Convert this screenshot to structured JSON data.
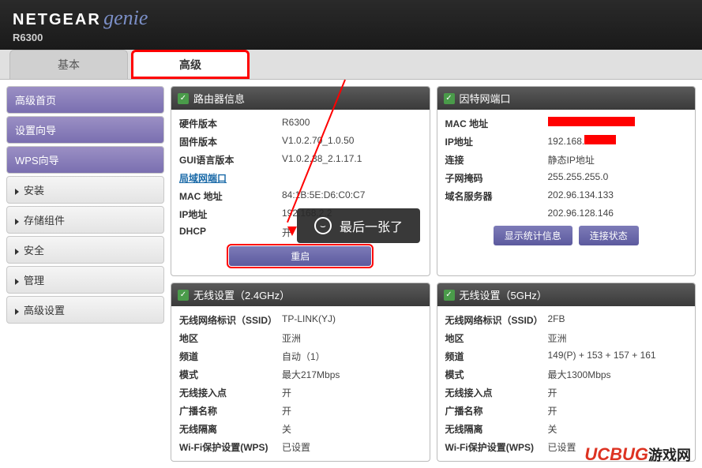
{
  "header": {
    "brand": "NETGEAR",
    "genie": "genie",
    "model": "R6300"
  },
  "tabs": {
    "basic": "基本",
    "advanced": "高级"
  },
  "sidebar": [
    {
      "label": "高级首页",
      "active": true,
      "arrow": false
    },
    {
      "label": "设置向导",
      "active": true,
      "arrow": false
    },
    {
      "label": "WPS向导",
      "active": true,
      "arrow": false
    },
    {
      "label": "安装",
      "active": false,
      "arrow": true
    },
    {
      "label": "存储组件",
      "active": false,
      "arrow": true
    },
    {
      "label": "安全",
      "active": false,
      "arrow": true
    },
    {
      "label": "管理",
      "active": false,
      "arrow": true
    },
    {
      "label": "高级设置",
      "active": false,
      "arrow": true
    }
  ],
  "panels": {
    "router": {
      "title": "路由器信息",
      "rows": [
        {
          "k": "硬件版本",
          "v": "R6300"
        },
        {
          "k": "固件版本",
          "v": "V1.0.2.70_1.0.50"
        },
        {
          "k": "GUI语言版本",
          "v": "V1.0.2.38_2.1.17.1"
        }
      ],
      "lanlink": "局域网端口",
      "rows2": [
        {
          "k": "MAC 地址",
          "v": "84:1B:5E:D6:C0:C7"
        },
        {
          "k": "IP地址",
          "v": "192.168.2.2"
        },
        {
          "k": "DHCP",
          "v": "开"
        }
      ],
      "btn": "重启"
    },
    "internet": {
      "title": "因特网端口",
      "rows": [
        {
          "k": "MAC 地址",
          "v": "",
          "red": true
        },
        {
          "k": "IP地址",
          "v": "192.168.",
          "red2": true
        },
        {
          "k": "连接",
          "v": "静态IP地址"
        },
        {
          "k": "子网掩码",
          "v": "255.255.255.0"
        },
        {
          "k": "域名服务器",
          "v": "202.96.134.133"
        },
        {
          "k": "",
          "v": "202.96.128.146"
        }
      ],
      "btn1": "显示统计信息",
      "btn2": "连接状态"
    },
    "w24": {
      "title": "无线设置（2.4GHz）",
      "rows": [
        {
          "k": "无线网络标识（SSID）",
          "v": "TP-LINK(YJ)"
        },
        {
          "k": "地区",
          "v": "亚洲"
        },
        {
          "k": "频道",
          "v": "自动（1）"
        },
        {
          "k": "模式",
          "v": "最大217Mbps"
        },
        {
          "k": "无线接入点",
          "v": "开"
        },
        {
          "k": "广播名称",
          "v": "开"
        },
        {
          "k": "无线隔离",
          "v": "关"
        },
        {
          "k": "Wi-Fi保护设置(WPS)",
          "v": "已设置"
        }
      ]
    },
    "w5": {
      "title": "无线设置（5GHz）",
      "rows": [
        {
          "k": "无线网络标识（SSID）",
          "v": "2FB"
        },
        {
          "k": "地区",
          "v": "亚洲"
        },
        {
          "k": "频道",
          "v": "149(P) + 153 + 157 + 161"
        },
        {
          "k": "模式",
          "v": "最大1300Mbps"
        },
        {
          "k": "无线接入点",
          "v": "开"
        },
        {
          "k": "广播名称",
          "v": "开"
        },
        {
          "k": "无线隔离",
          "v": "关"
        },
        {
          "k": "Wi-Fi保护设置(WPS)",
          "v": "已设置"
        }
      ]
    }
  },
  "overlay": "最后一张了",
  "watermark": {
    "en": "UCBUG",
    "cn": "游戏网"
  }
}
